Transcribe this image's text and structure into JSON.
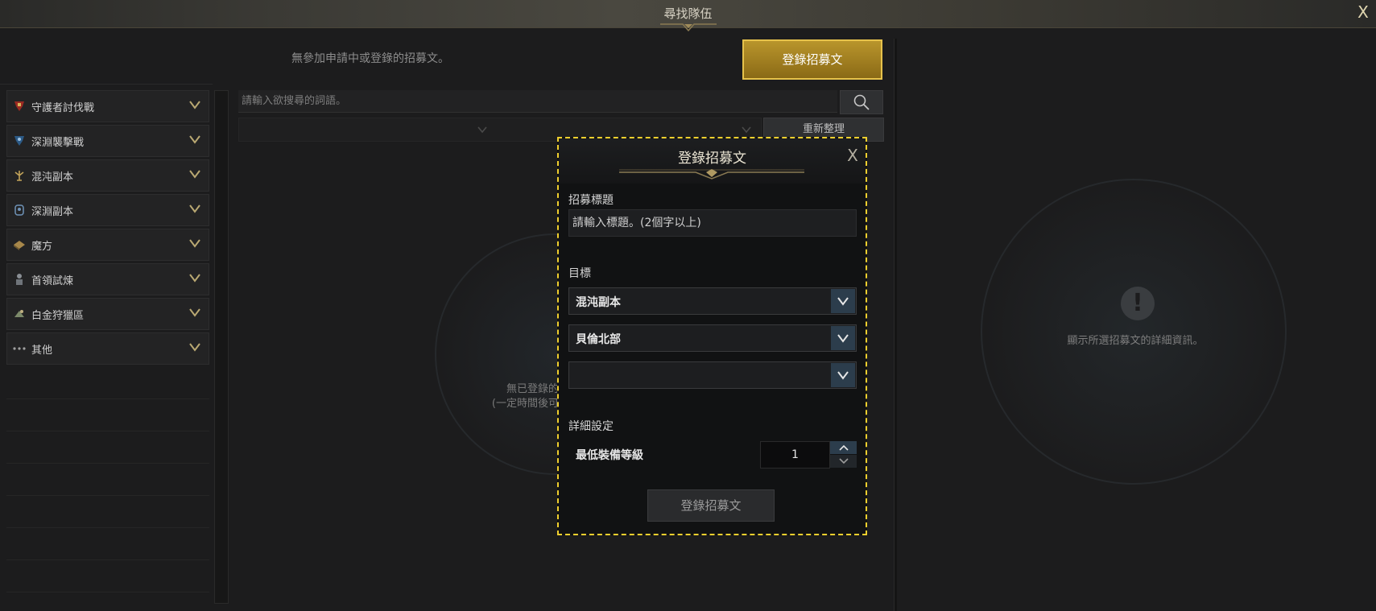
{
  "window": {
    "title": "尋找隊伍",
    "close_glyph": "X"
  },
  "top": {
    "no_apply_text": "無參加申請中或登錄的招募文。",
    "register_button": "登錄招募文"
  },
  "sidebar": {
    "items": [
      {
        "label": "守護者討伐戰",
        "icon": "guardian-icon"
      },
      {
        "label": "深淵襲擊戰",
        "icon": "abyss-raid-icon"
      },
      {
        "label": "混沌副本",
        "icon": "chaos-dungeon-icon"
      },
      {
        "label": "深淵副本",
        "icon": "abyss-dungeon-icon"
      },
      {
        "label": "魔方",
        "icon": "cube-icon"
      },
      {
        "label": "首領試煉",
        "icon": "boss-trial-icon"
      },
      {
        "label": "白金狩獵區",
        "icon": "platinum-field-icon"
      },
      {
        "label": "其他",
        "icon": "more-icon"
      }
    ]
  },
  "search": {
    "placeholder": "請輸入欲搜尋的詞語。",
    "refresh_label": "重新整理"
  },
  "center": {
    "empty_line1": "無已登錄的隊伍",
    "empty_line2": "(一定時間後可搜尋"
  },
  "detail": {
    "placeholder": "顯示所選招募文的詳細資訊。"
  },
  "modal": {
    "title": "登錄招募文",
    "close_glyph": "X",
    "recruit_title_label": "招募標題",
    "recruit_title_placeholder": "請輸入標題。(2個字以上)",
    "target_label": "目標",
    "target_select_1": "混沌副本",
    "target_select_2": "貝倫北部",
    "target_select_3": "",
    "detail_label": "詳細設定",
    "min_gear_label": "最低裝備等級",
    "min_gear_value": "1",
    "register_button": "登錄招募文"
  },
  "colors": {
    "accent_gold": "#b9952c",
    "highlight_border": "#f0cf2e",
    "select_arrow_bg": "#2c3d4c"
  }
}
